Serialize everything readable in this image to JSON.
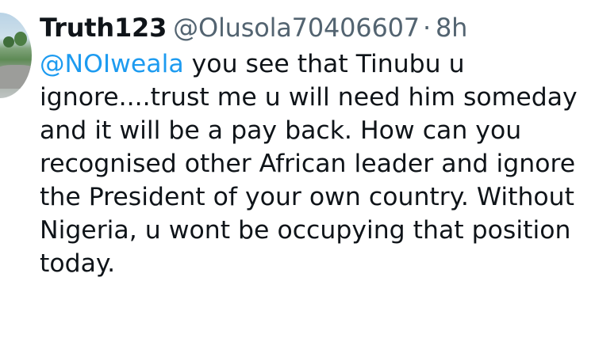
{
  "tweet": {
    "author_name": "Truth123",
    "author_handle": "@Olusola70406607",
    "separator": "·",
    "timestamp": "8h",
    "mention": "@NOIweala",
    "lines": [
      " you see that Tinubu u",
      "ignore....trust me u will need him someday",
      "and it will be a pay back. How can you",
      "recognised other African leader and ignore",
      "the President of your own country. Without",
      "Nigeria, u wont be occupying that position",
      "today."
    ]
  },
  "colors": {
    "text": "#0f1419",
    "secondary": "#536471",
    "link": "#1d9bf0",
    "background": "#ffffff"
  },
  "icons": {
    "avatar": "profile-photo"
  }
}
